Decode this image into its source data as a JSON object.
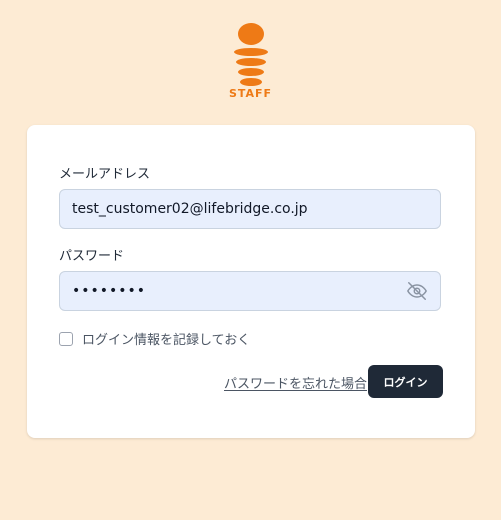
{
  "logo": {
    "text": "STAFF",
    "color": "#ee7a16"
  },
  "form": {
    "email_label": "メールアドレス",
    "email_value": "test_customer02@lifebridge.co.jp",
    "password_label": "パスワード",
    "password_value": "••••••••",
    "password_toggle_icon": "eye-off-icon",
    "remember_label": "ログイン情報を記録しておく",
    "remember_checked": false,
    "forgot_link": "パスワードを忘れた場合",
    "login_button": "ログイン"
  },
  "colors": {
    "page_background": "#fdebd4",
    "field_background": "#e8effd",
    "button_background": "#1f2937"
  }
}
